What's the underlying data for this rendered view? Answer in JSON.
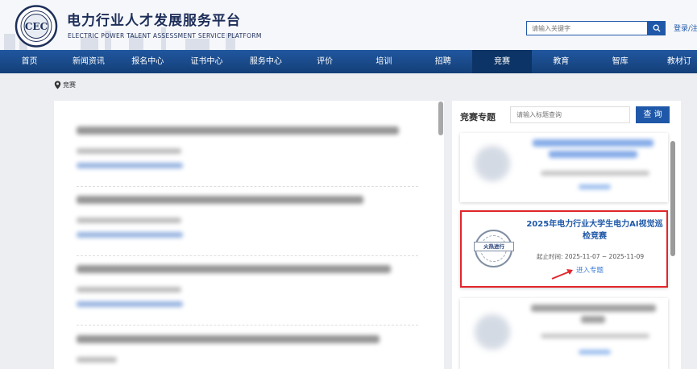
{
  "header": {
    "logo_text": "CEC",
    "title_cn": "电力行业人才发展服务平台",
    "title_en": "ELECTRIC POWER TALENT ASSESSMENT SERVICE PLATFORM",
    "search_placeholder": "请输入关键字",
    "login_label": "登录/注"
  },
  "nav": {
    "items": [
      "首页",
      "新闻资讯",
      "报名中心",
      "证书中心",
      "服务中心",
      "评价",
      "培训",
      "招聘",
      "竞赛",
      "教育",
      "智库",
      "教材订"
    ],
    "active": "竞赛"
  },
  "breadcrumb": {
    "current": "竞赛"
  },
  "right_panel": {
    "title": "竞赛专题",
    "search_placeholder": "请输入标题查询",
    "search_button": "查 询",
    "featured": {
      "badge": "火热进行",
      "title": "2025年电力行业大学生电力AI视觉巡检竞赛",
      "date_label": "起止时间:",
      "date_range": "2025-11-07 ~ 2025-11-09",
      "link": "进入专题"
    }
  },
  "colors": {
    "brand": "#1f58a8",
    "nav": "#1a4d91",
    "highlight": "#e2262b"
  }
}
